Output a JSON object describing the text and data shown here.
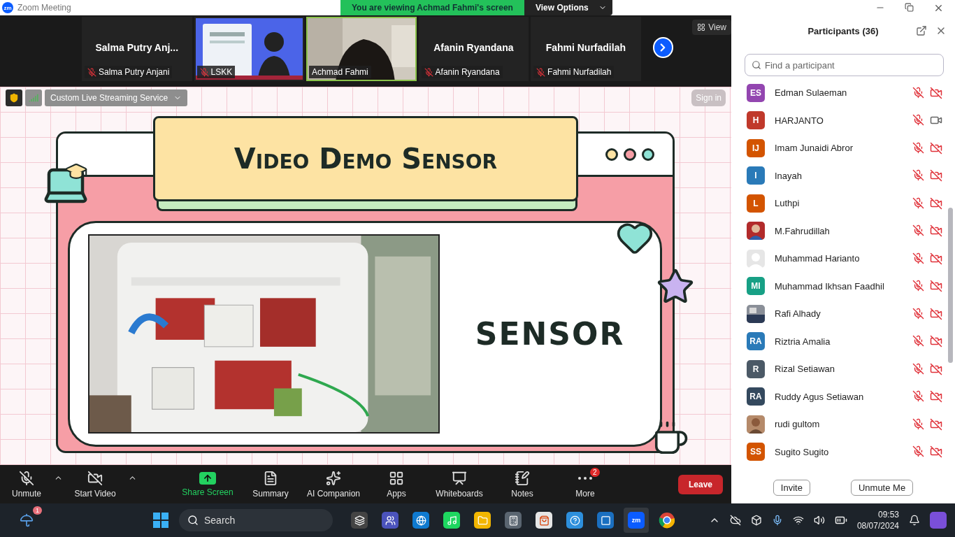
{
  "window": {
    "logo": "zm",
    "title": "Zoom Meeting"
  },
  "share_banner": {
    "text": "You are viewing Achmad Fahmi's screen",
    "button": "View Options"
  },
  "video_strip": {
    "view_button": "View",
    "tiles": [
      {
        "kind": "name",
        "title": "Salma  Putry Anj...",
        "label": "Salma Putry Anjani",
        "muted": true,
        "active": false
      },
      {
        "kind": "video",
        "label": "LSKK",
        "muted": true,
        "active": false
      },
      {
        "kind": "video",
        "label": "Achmad Fahmi",
        "muted": false,
        "active": true
      },
      {
        "kind": "name",
        "title": "Afanin Ryandana",
        "label": "Afanin Ryandana",
        "muted": true,
        "active": false
      },
      {
        "kind": "name",
        "title": "Fahmi Nurfadilah",
        "label": "Fahmi Nurfadilah",
        "muted": true,
        "active": false
      }
    ]
  },
  "share_toolbar": {
    "streaming": "Custom Live Streaming Service",
    "sign_in": "Sign in"
  },
  "slide": {
    "title": "Video Demo Sensor",
    "caption": "SENSOR"
  },
  "toolbar": {
    "items": [
      {
        "kind": "mic",
        "label": "Unmute",
        "menu": true
      },
      {
        "kind": "video",
        "label": "Start Video",
        "menu": true
      },
      {
        "kind": "share",
        "label": "Share Screen",
        "menu": false
      },
      {
        "kind": "summary",
        "label": "Summary",
        "menu": false
      },
      {
        "kind": "ai",
        "label": "AI Companion",
        "menu": false
      },
      {
        "kind": "apps",
        "label": "Apps",
        "menu": false
      },
      {
        "kind": "whiteboards",
        "label": "Whiteboards",
        "menu": false
      },
      {
        "kind": "notes",
        "label": "Notes",
        "menu": false
      },
      {
        "kind": "more",
        "label": "More",
        "menu": false,
        "badge": "2"
      }
    ],
    "leave": "Leave"
  },
  "participants": {
    "title": "Participants (36)",
    "search_placeholder": "Find a participant",
    "items": [
      {
        "name": "Edman Sulaeman",
        "kind": "initials",
        "initials": "ES",
        "color": "#9346b0",
        "muted": true,
        "video_off": true
      },
      {
        "name": "HARJANTO",
        "kind": "initials",
        "initials": "H",
        "color": "#c0392b",
        "muted": true,
        "video_off": false
      },
      {
        "name": "Imam Junaidi Abror",
        "kind": "initials",
        "initials": "IJ",
        "color": "#d35400",
        "muted": true,
        "video_off": true
      },
      {
        "name": "Inayah",
        "kind": "initials",
        "initials": "I",
        "color": "#2a7ab8",
        "muted": true,
        "video_off": true
      },
      {
        "name": "Luthpi",
        "kind": "initials",
        "initials": "L",
        "color": "#d35400",
        "muted": true,
        "video_off": true
      },
      {
        "name": "M.Fahrudillah",
        "muted": true,
        "video_off": true
      },
      {
        "name": "Muhammad Harianto",
        "kind": "default",
        "muted": true,
        "video_off": true
      },
      {
        "name": "Muhammad Ikhsan Faadhil",
        "kind": "initials",
        "initials": "MI",
        "color": "#17a085",
        "muted": true,
        "video_off": true
      },
      {
        "name": "Rafi Alhady",
        "muted": true,
        "video_off": true
      },
      {
        "name": "Riztria Amalia",
        "kind": "initials",
        "initials": "RA",
        "color": "#2a7ab8",
        "muted": true,
        "video_off": true
      },
      {
        "name": "Rizal Setiawan",
        "kind": "initials",
        "initials": "R",
        "color": "#4b5966",
        "muted": true,
        "video_off": true
      },
      {
        "name": "Ruddy Agus Setiawan",
        "kind": "initials",
        "initials": "RA",
        "color": "#34495e",
        "muted": true,
        "video_off": true
      },
      {
        "name": "rudi gultom",
        "muted": true,
        "video_off": true
      },
      {
        "name": "Sugito Sugito",
        "kind": "initials",
        "initials": "SS",
        "color": "#d35400",
        "muted": true,
        "video_off": true
      }
    ],
    "buttons": [
      "Invite",
      "Unmute Me"
    ]
  },
  "taskbar": {
    "weather_badge": "1",
    "search_placeholder": "Search",
    "zoom_label": "zm",
    "time": "09:53",
    "date": "08/07/2024"
  }
}
